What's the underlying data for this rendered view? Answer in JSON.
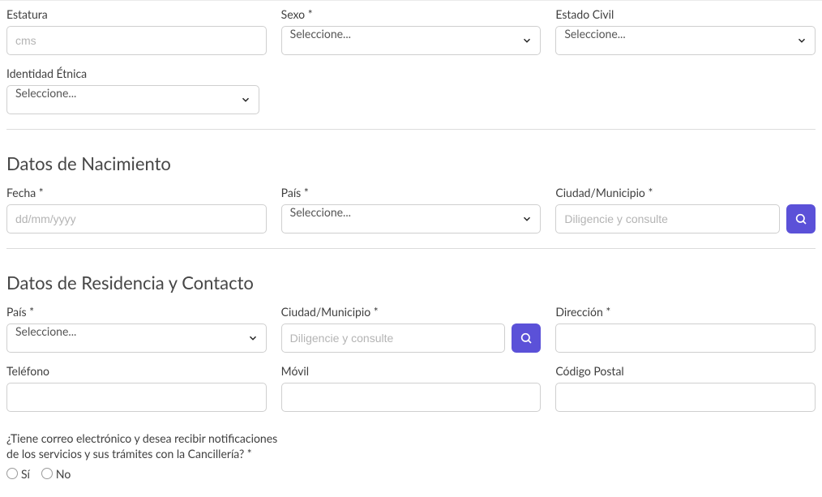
{
  "top": {
    "estatura": {
      "label": "Estatura",
      "placeholder": "cms"
    },
    "sexo": {
      "label": "Sexo *",
      "selected": "Seleccione..."
    },
    "estado_civil": {
      "label": "Estado Civil",
      "selected": "Seleccione..."
    },
    "identidad_etnica": {
      "label": "Identidad Étnica",
      "selected": "Seleccione..."
    }
  },
  "nacimiento": {
    "title": "Datos de Nacimiento",
    "fecha": {
      "label": "Fecha *",
      "placeholder": "dd/mm/yyyy"
    },
    "pais": {
      "label": "País *",
      "selected": "Seleccione..."
    },
    "ciudad": {
      "label": "Ciudad/Municipio *",
      "placeholder": "Diligencie y consulte"
    }
  },
  "residencia": {
    "title": "Datos de Residencia y Contacto",
    "pais": {
      "label": "País *",
      "selected": "Seleccione..."
    },
    "ciudad": {
      "label": "Ciudad/Municipio *",
      "placeholder": "Diligencie y consulte"
    },
    "direccion": {
      "label": "Dirección *"
    },
    "telefono": {
      "label": "Teléfono"
    },
    "movil": {
      "label": "Móvil"
    },
    "codigo_postal": {
      "label": "Código Postal"
    }
  },
  "email_question": {
    "text": "¿Tiene correo electrónico y desea recibir notificaciones de los servicios y sus trámites con la Cancillería? *",
    "options": {
      "si": "Sí",
      "no": "No"
    }
  }
}
